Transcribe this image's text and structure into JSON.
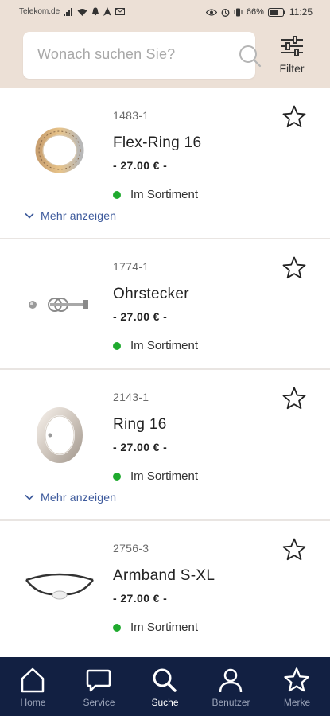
{
  "status": {
    "carrier": "Telekom.de",
    "battery": "66%",
    "time": "11:25"
  },
  "search": {
    "placeholder": "Wonach suchen Sie?"
  },
  "filter": {
    "label": "Filter"
  },
  "products": [
    {
      "sku": "1483-1",
      "name": "Flex-Ring 16",
      "price": "- 27.00 € -",
      "availability": "Im Sortiment",
      "more": "Mehr anzeigen"
    },
    {
      "sku": "1774-1",
      "name": "Ohrstecker",
      "price": "- 27.00 € -",
      "availability": "Im Sortiment"
    },
    {
      "sku": "2143-1",
      "name": "Ring 16",
      "price": "- 27.00 € -",
      "availability": "Im Sortiment",
      "more": "Mehr anzeigen"
    },
    {
      "sku": "2756-3",
      "name": "Armband S-XL",
      "price": "- 27.00 € -",
      "availability": "Im Sortiment"
    }
  ],
  "nav": {
    "home": "Home",
    "service": "Service",
    "search": "Suche",
    "user": "Benutzer",
    "saved": "Merke",
    "active": "Suche"
  },
  "colors": {
    "header_bg": "#ece0d6",
    "nav_bg": "#122042",
    "in_stock": "#1faa2e",
    "link": "#3d5a9c"
  }
}
